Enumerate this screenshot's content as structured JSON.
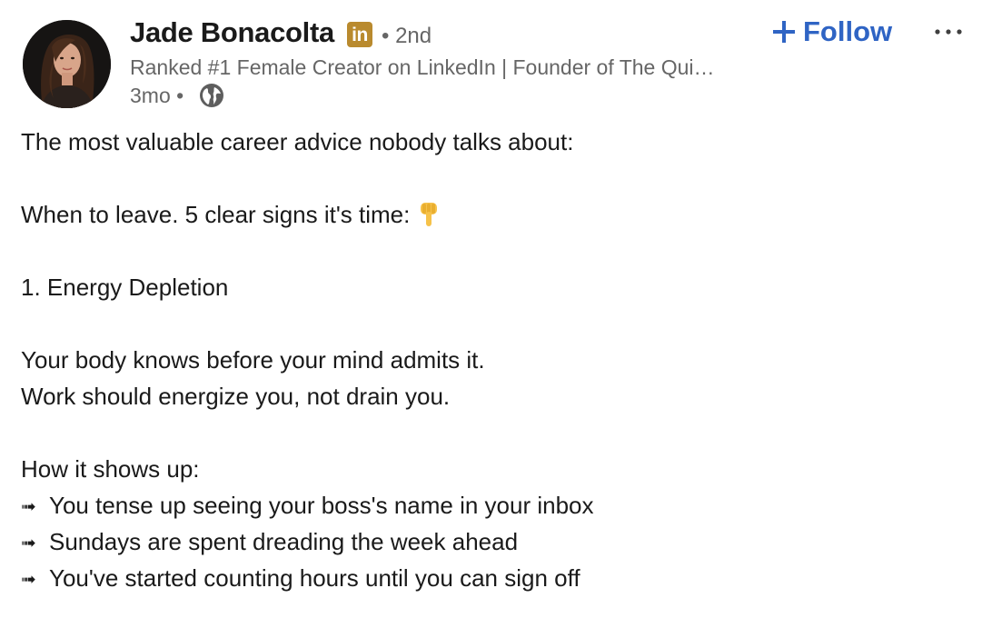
{
  "author": {
    "name": "Jade Bonacolta",
    "badge_text": "in",
    "degree": "• 2nd",
    "headline": "Ranked #1 Female Creator on LinkedIn | Founder of The Qui…",
    "time": "3mo •",
    "visibility_icon": "globe-icon"
  },
  "actions": {
    "follow_label": "Follow",
    "follow_icon": "plus-icon",
    "more_icon": "ellipsis-icon",
    "accent_color": "#2f64c4"
  },
  "post": {
    "line1": "The most valuable career advice nobody talks about:",
    "line2": "When to leave. 5 clear signs it's time:",
    "line2_emoji": "backhand-index-pointing-down",
    "line3": "1. Energy Depletion",
    "line4": "Your body knows before your mind admits it.",
    "line5": "Work should energize you, not drain you.",
    "line6": "How it shows up:",
    "bullet_glyph": "➟",
    "bullets": [
      "You tense up seeing your boss's name in your inbox",
      "Sundays are spent dreading the week ahead",
      "You've started counting hours until you can sign off"
    ]
  }
}
